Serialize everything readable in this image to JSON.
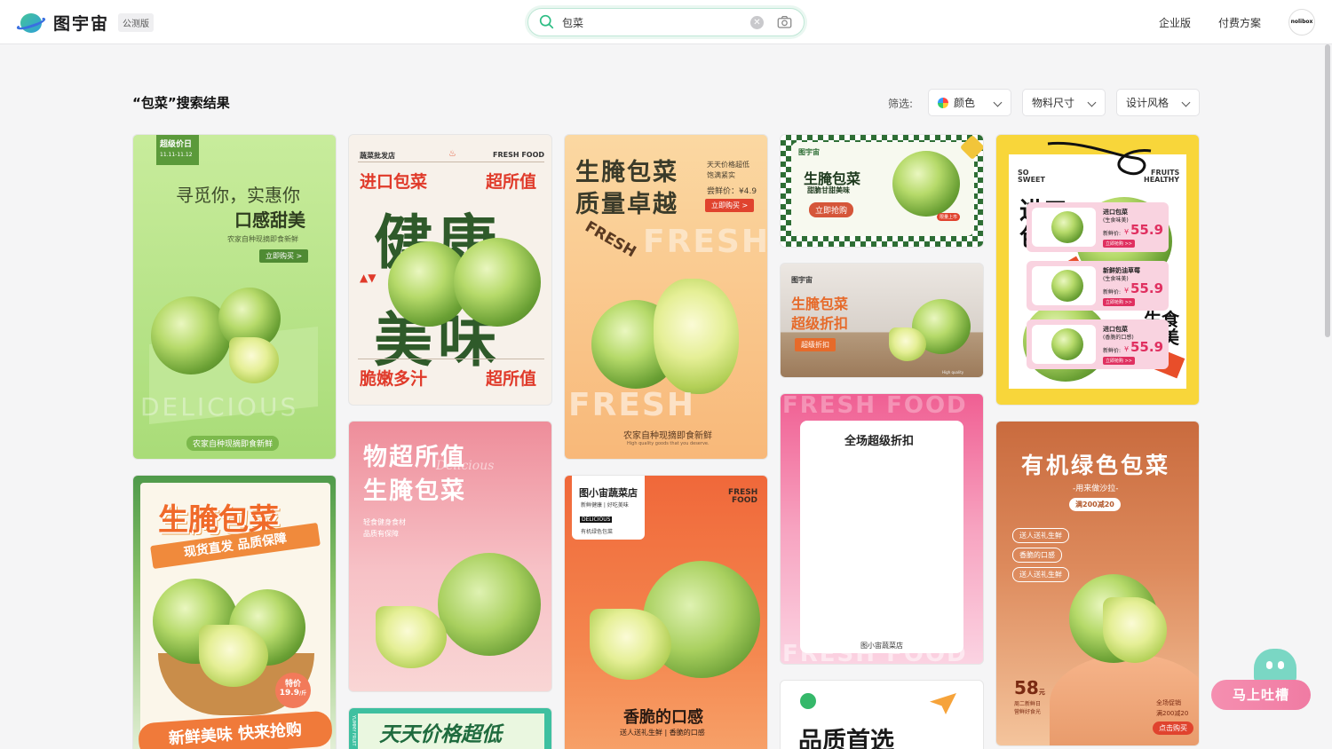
{
  "app": {
    "name": "图宇宙",
    "badge": "公测版"
  },
  "search": {
    "value": "包菜",
    "icons": {
      "search": "search-icon",
      "clear": "clear-icon",
      "camera": "camera-icon"
    }
  },
  "nav": {
    "enterprise": "企业版",
    "pricing": "付费方案",
    "avatar": "nolibox"
  },
  "results": {
    "title": "“包菜”搜索结果",
    "filter_label": "筛选:",
    "filters": [
      {
        "label": "颜色",
        "icon": "color-wheel-icon"
      },
      {
        "label": "物料尺寸"
      },
      {
        "label": "设计风格"
      }
    ]
  },
  "cards": {
    "c1": {
      "badge": "超级价日",
      "date": "11.11-11.12",
      "line1": "寻觅你，实惠你",
      "line2": "口感甜美",
      "sub": "农家自种现摘即食新鲜",
      "btn": "立即购买 >",
      "bg_word": "DELICIOUS",
      "bottom_pill": "农家自种现摘即食新鲜"
    },
    "c2": {
      "shop": "蔬菜批发店",
      "brand": "FRESH FOOD",
      "t1": "进口包菜",
      "t2": "超所值",
      "big": "健康",
      "big2": "美味",
      "b1": "脆嫩多汁",
      "b2": "超所值"
    },
    "c3": {
      "title1": "生腌包菜",
      "title2": "质量卓越",
      "side1": "天天价格超低",
      "side2": "饱满紧实",
      "price": "尝鲜价：¥4.9",
      "btn": "立即购买 >",
      "word": "FRESH",
      "bottom": "农家自种现摘即食新鲜",
      "bottom_small": "High quality goods that you deserve."
    },
    "c4": {
      "brand": "图宇宙",
      "t1": "生腌包菜",
      "t2": "甜脆甘甜美味",
      "btn": "立即抢购",
      "tag": "限量上市"
    },
    "c5": {
      "brand": "图宇宙",
      "t1": "生腌包菜",
      "t2": "超级折扣",
      "btn": "超级折扣",
      "note": "High quality"
    },
    "c6": {
      "so": "SO",
      "sweet": "SWEET",
      "fruits": "FRUITS",
      "healthy": "HEALTHY",
      "t1": "进口",
      "t2": "包菜",
      "tag1": "商品",
      "t3": "生食",
      "t4": "味美",
      "tag2": "商品"
    },
    "c7": {
      "t1": "生腌包菜",
      "t2": "现货直发 品质保障",
      "special": "特价",
      "price": "19.9",
      "unit": "/斤",
      "bottom": "新鲜美味 快来抢购"
    },
    "c8": {
      "t1": "物超所值",
      "t2": "生腌包菜",
      "script": "Delicious",
      "s1": "轻食健身食材",
      "s2": "品质有保障"
    },
    "c9": {
      "t1": "天天价格超低",
      "side": "YUMMY FRUIT"
    },
    "c10": {
      "shop": "图小宙蔬菜店",
      "sub": "新鲜健康 | 好吃美味",
      "tag": "DELICIOUS",
      "desc": "有机绿色包菜",
      "brand1": "FRESH",
      "brand2": "FOOD",
      "t1": "香脆的口感",
      "t2": "送人送礼生鲜 | 香脆的口感"
    },
    "c11": {
      "bg_word": "FRESH FOOD",
      "title": "全场超级折扣",
      "items": [
        {
          "name": "进口包菜",
          "sub": "(生食味美)",
          "label": "新鲜价:",
          "currency": "¥",
          "price": "55.9",
          "btn": "立即抢购 >>"
        },
        {
          "name": "新鲜奶油草莓",
          "sub": "(生食味美)",
          "label": "新鲜价:",
          "currency": "¥",
          "price": "55.9",
          "btn": "立即抢购 >>"
        },
        {
          "name": "进口包菜",
          "sub": "(香脆的口感)",
          "label": "新鲜价:",
          "currency": "¥",
          "price": "55.9",
          "btn": "立即抢购 >>"
        }
      ],
      "footer": "图小宙蔬菜店"
    },
    "c12": {
      "title": "品质首选"
    },
    "c13": {
      "t1": "有机绿色包菜",
      "t2": "-用来做沙拉-",
      "badge": "满200减20",
      "tags": [
        "送人送礼生鲜",
        "香脆的口感",
        "送人送礼生鲜"
      ],
      "price": "58",
      "unit": "元",
      "note1": "周二新鲜日",
      "note2": "营鲜好食光",
      "r1": "全场促销",
      "r2": "满200减20",
      "btn": "点击购买"
    }
  },
  "feedback": {
    "label": "马上吐槽"
  },
  "colors": {
    "accent": "#2dbd84",
    "pink": "#f07ba3"
  }
}
